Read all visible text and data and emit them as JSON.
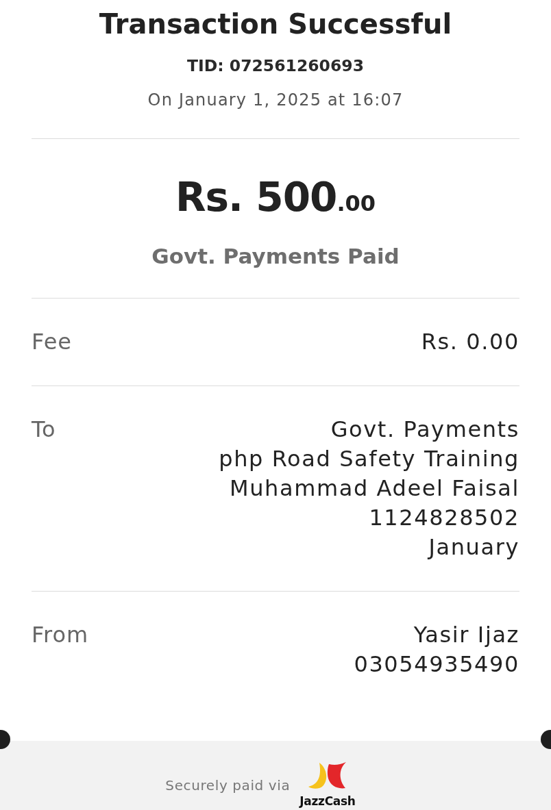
{
  "header": {
    "title": "Transaction Successful",
    "tid": "TID: 072561260693",
    "date": "On January 1, 2025 at 16:07"
  },
  "amount": {
    "main": "Rs. 500",
    "decimals": ".00",
    "caption": "Govt. Payments Paid"
  },
  "details": [
    {
      "label": "Fee",
      "lines": [
        "Rs. 0.00"
      ]
    },
    {
      "label": "To",
      "lines": [
        "Govt. Payments",
        "php Road Safety Training",
        "Muhammad Adeel Faisal",
        "1124828502",
        "January"
      ]
    },
    {
      "label": "From",
      "lines": [
        "Yasir Ijaz",
        "03054935490"
      ]
    }
  ],
  "footer": {
    "text": "Securely paid via",
    "brand": "JazzCash"
  }
}
